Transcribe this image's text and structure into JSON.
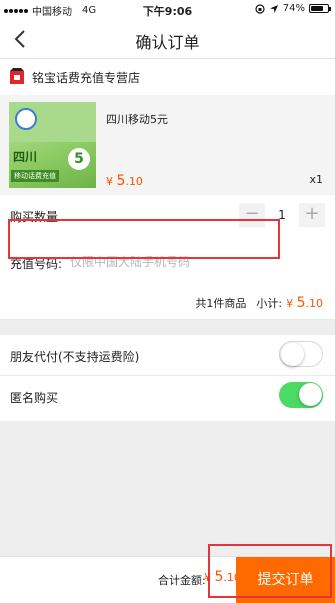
{
  "status_bar": {
    "carrier": "中国移动",
    "network": "4G",
    "time": "下午9:06",
    "battery": "74%",
    "battery_level": 0.74
  },
  "nav": {
    "title": "确认订单"
  },
  "shop": {
    "name": "铭宝话费充值专营店"
  },
  "product": {
    "title": "四川移动5元",
    "price_symbol": "¥",
    "price_int": "5",
    "price_dec": ".10",
    "quantity": "x1",
    "image": {
      "province": "四川",
      "subtitle": "移动话费充值",
      "badge": "5"
    }
  },
  "purchase_quantity": {
    "label": "购买数量",
    "minus": "−",
    "value": "1",
    "plus": "+"
  },
  "recharge": {
    "label": "充值号码:",
    "placeholder": "仅限中国大陆手机号码"
  },
  "subtotal": {
    "items_text": "共1件商品",
    "label": "小计:",
    "price_symbol": "¥",
    "price_int": "5",
    "price_dec": ".10"
  },
  "friend_pay": {
    "label": "朋友代付(不支持运费险)",
    "enabled": false
  },
  "anonymous": {
    "label": "匿名购买",
    "enabled": true
  },
  "footer": {
    "total_label": "合计金额:",
    "price_symbol": "¥",
    "price_int": "5",
    "price_dec": ".10",
    "submit_label": "提交订单"
  },
  "colors": {
    "accent": "#ff6a00",
    "price": "#ff5000",
    "toggle_on": "#4cd964",
    "highlight_box": "#e5343c"
  }
}
